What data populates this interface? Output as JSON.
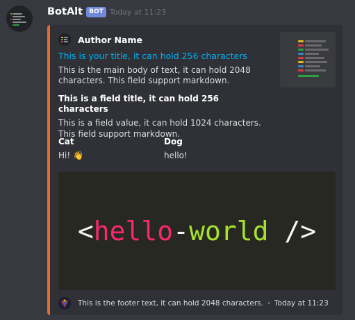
{
  "message": {
    "username": "BotAlt",
    "bot_tag": "BOT",
    "timestamp": "Today at 11:23"
  },
  "embed": {
    "color": "#e66a2c",
    "author_name": "Author Name",
    "title": "This is your title, it can hold 256 characters",
    "description": "This is the main body of text, it can hold 2048 characters. This field support markdown.",
    "fields": [
      {
        "name": "This is a field title, it can hold 256 characters",
        "value": "This is a field value, it can hold 1024 characters. This field support markdown."
      },
      {
        "name": "Cat",
        "value": "Hi! 👋"
      },
      {
        "name": "Dog",
        "value": "hello!"
      }
    ],
    "image": {
      "open": "<",
      "word1": "hello",
      "dash": "-",
      "word2": "world",
      "close": " />"
    },
    "footer_text": "This is the footer text, it can hold 2048 characters.",
    "footer_sep": "•",
    "footer_time": "Today at 11:23"
  },
  "icons": {
    "avatar": "code-editor-avatar-icon",
    "author_icon": "code-editor-author-icon",
    "thumbnail": "code-editor-thumbnail",
    "footer_icon": "superhero-footer-icon"
  }
}
